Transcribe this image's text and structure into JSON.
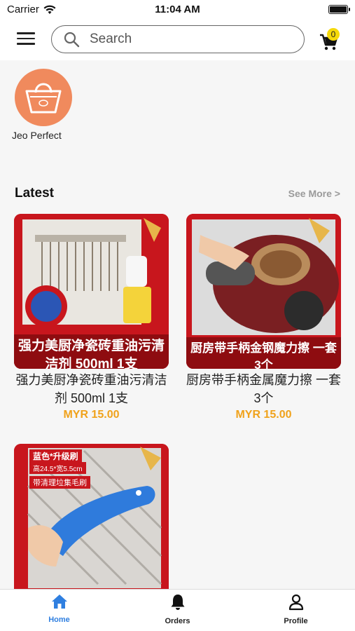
{
  "status": {
    "carrier": "Carrier",
    "time": "11:04 AM"
  },
  "header": {
    "search_placeholder": "Search",
    "cart_count": "0"
  },
  "store": {
    "name": "Jeo Perfect"
  },
  "latest": {
    "title": "Latest",
    "see_more": "See More >"
  },
  "products": [
    {
      "title": "强力美厨净瓷砖重油污清洁剂 500ml 1支",
      "price": "MYR 15.00",
      "banner": "强力美厨净瓷砖重油污清洁剂 500ml 1支"
    },
    {
      "title": "厨房带手柄金属魔力擦 一套3个",
      "price": "MYR 15.00",
      "banner": "厨房带手柄金钢魔力擦 一套3个"
    },
    {
      "title": "",
      "price": "",
      "banner_tags": [
        "蓝色*升级刷",
        "高24.5*宽5.5cm",
        "带清理垃集毛刷"
      ]
    }
  ],
  "tabs": [
    {
      "label": "Home",
      "icon": "home-icon",
      "active": true
    },
    {
      "label": "Orders",
      "icon": "bell-icon",
      "active": false
    },
    {
      "label": "Profile",
      "icon": "person-icon",
      "active": false
    }
  ],
  "colors": {
    "accent": "#2f7fe0",
    "price": "#f0a21b",
    "badge": "#f5d90a",
    "store_avatar": "#f08a5d",
    "product_red": "#c8161d"
  }
}
